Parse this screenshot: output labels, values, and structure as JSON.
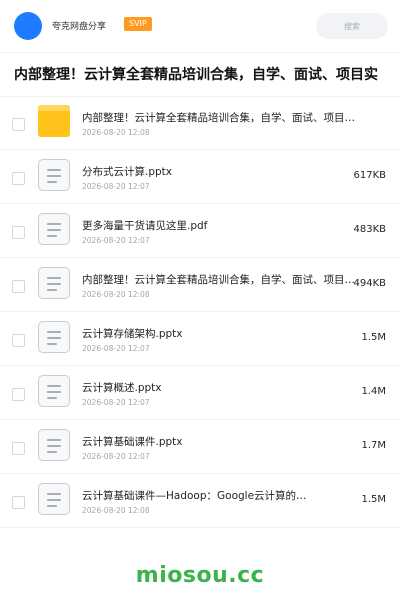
{
  "header": {
    "app_name": "夸克网盘分享",
    "badge": "SVIP",
    "search_placeholder": "搜索",
    "accent_color": "#1f7bff",
    "badge_color": "#ff9a1f"
  },
  "page_title": "内部整理！云计算全套精品培训合集，自学、面试、项目实",
  "files": [
    {
      "type": "folder",
      "icon": "folder-icon",
      "name": "内部整理！云计算全套精品培训合集，自学、面试、项目…",
      "date": "2026-08-20 12:08",
      "size": ""
    },
    {
      "type": "file",
      "icon": "document-icon",
      "name": "分布式云计算.pptx",
      "date": "2026-08-20 12:07",
      "size": "617KB"
    },
    {
      "type": "file",
      "icon": "document-icon",
      "name": "更多海量干货请见这里.pdf",
      "date": "2026-08-20 12:07",
      "size": "483KB"
    },
    {
      "type": "file",
      "icon": "document-icon",
      "name": "内部整理！云计算全套精品培训合集，自学、面试、项目…",
      "date": "2026-08-20 12:08",
      "size": "494KB"
    },
    {
      "type": "file",
      "icon": "document-icon",
      "name": "云计算存储架构.pptx",
      "date": "2026-08-20 12:07",
      "size": "1.5M"
    },
    {
      "type": "file",
      "icon": "document-icon",
      "name": "云计算概述.pptx",
      "date": "2026-08-20 12:07",
      "size": "1.4M"
    },
    {
      "type": "file",
      "icon": "document-icon",
      "name": "云计算基础课件.pptx",
      "date": "2026-08-20 12:07",
      "size": "1.7M"
    },
    {
      "type": "file",
      "icon": "document-icon",
      "name": "云计算基础课件—Hadoop：Google云计算的…",
      "date": "2026-08-20 12:08",
      "size": "1.5M"
    }
  ],
  "watermark": "miosou.cc",
  "watermark_color": "#3cb34a"
}
